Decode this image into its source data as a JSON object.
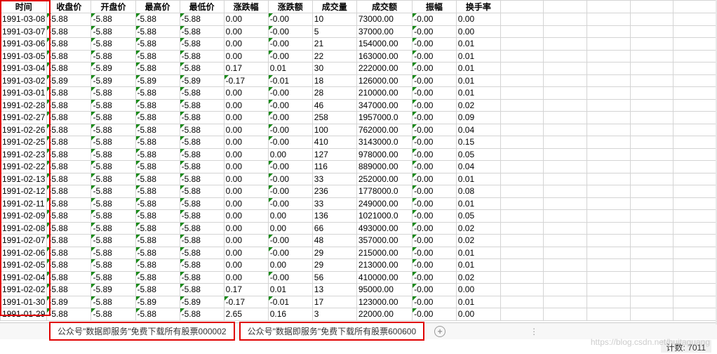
{
  "headers": [
    "时间",
    "收盘价",
    "开盘价",
    "最高价",
    "最低价",
    "涨跌幅",
    "涨跌额",
    "成交量",
    "成交额",
    "振幅",
    "换手率"
  ],
  "rows": [
    [
      "1991-03-08",
      "-5.88",
      "-5.88",
      "-5.88",
      "-5.88",
      "0.00",
      "-0.00",
      "10",
      "73000.00",
      "-0.00",
      "0.00"
    ],
    [
      "1991-03-07",
      "-5.88",
      "-5.88",
      "-5.88",
      "-5.88",
      "0.00",
      "-0.00",
      "5",
      "37000.00",
      "-0.00",
      "0.00"
    ],
    [
      "1991-03-06",
      "-5.88",
      "-5.88",
      "-5.88",
      "-5.88",
      "0.00",
      "-0.00",
      "21",
      "154000.00",
      "-0.00",
      "0.01"
    ],
    [
      "1991-03-05",
      "-5.88",
      "-5.88",
      "-5.88",
      "-5.88",
      "0.00",
      "-0.00",
      "22",
      "163000.00",
      "-0.00",
      "0.01"
    ],
    [
      "1991-03-04",
      "-5.88",
      "-5.89",
      "-5.88",
      "-5.88",
      "0.17",
      "0.01",
      "30",
      "222000.00",
      "-0.00",
      "0.01"
    ],
    [
      "1991-03-02",
      "-5.89",
      "-5.89",
      "-5.89",
      "-5.89",
      "-0.17",
      "-0.01",
      "18",
      "126000.00",
      "-0.00",
      "0.01"
    ],
    [
      "1991-03-01",
      "-5.88",
      "-5.88",
      "-5.88",
      "-5.88",
      "0.00",
      "-0.00",
      "28",
      "210000.00",
      "-0.00",
      "0.01"
    ],
    [
      "1991-02-28",
      "-5.88",
      "-5.88",
      "-5.88",
      "-5.88",
      "0.00",
      "-0.00",
      "46",
      "347000.00",
      "-0.00",
      "0.02"
    ],
    [
      "1991-02-27",
      "-5.88",
      "-5.88",
      "-5.88",
      "-5.88",
      "0.00",
      "-0.00",
      "258",
      "1957000.0",
      "-0.00",
      "0.09"
    ],
    [
      "1991-02-26",
      "-5.88",
      "-5.88",
      "-5.88",
      "-5.88",
      "0.00",
      "-0.00",
      "100",
      "762000.00",
      "-0.00",
      "0.04"
    ],
    [
      "1991-02-25",
      "-5.88",
      "-5.88",
      "-5.88",
      "-5.88",
      "0.00",
      "-0.00",
      "410",
      "3143000.0",
      "-0.00",
      "0.15"
    ],
    [
      "1991-02-23",
      "-5.88",
      "-5.88",
      "-5.88",
      "-5.88",
      "0.00",
      "0.00",
      "127",
      "978000.00",
      "-0.00",
      "0.05"
    ],
    [
      "1991-02-22",
      "-5.88",
      "-5.88",
      "-5.88",
      "-5.88",
      "0.00",
      "-0.00",
      "116",
      "889000.00",
      "-0.00",
      "0.04"
    ],
    [
      "1991-02-13",
      "-5.88",
      "-5.88",
      "-5.88",
      "-5.88",
      "0.00",
      "-0.00",
      "33",
      "252000.00",
      "-0.00",
      "0.01"
    ],
    [
      "1991-02-12",
      "-5.88",
      "-5.88",
      "-5.88",
      "-5.88",
      "0.00",
      "-0.00",
      "236",
      "1778000.0",
      "-0.00",
      "0.08"
    ],
    [
      "1991-02-11",
      "-5.88",
      "-5.88",
      "-5.88",
      "-5.88",
      "0.00",
      "-0.00",
      "33",
      "249000.00",
      "-0.00",
      "0.01"
    ],
    [
      "1991-02-09",
      "-5.88",
      "-5.88",
      "-5.88",
      "-5.88",
      "0.00",
      "0.00",
      "136",
      "1021000.0",
      "-0.00",
      "0.05"
    ],
    [
      "1991-02-08",
      "-5.88",
      "-5.88",
      "-5.88",
      "-5.88",
      "0.00",
      "0.00",
      "66",
      "493000.00",
      "-0.00",
      "0.02"
    ],
    [
      "1991-02-07",
      "-5.88",
      "-5.88",
      "-5.88",
      "-5.88",
      "0.00",
      "-0.00",
      "48",
      "357000.00",
      "-0.00",
      "0.02"
    ],
    [
      "1991-02-06",
      "-5.88",
      "-5.88",
      "-5.88",
      "-5.88",
      "0.00",
      "-0.00",
      "29",
      "215000.00",
      "-0.00",
      "0.01"
    ],
    [
      "1991-02-05",
      "-5.88",
      "-5.88",
      "-5.88",
      "-5.88",
      "0.00",
      "0.00",
      "29",
      "213000.00",
      "-0.00",
      "0.01"
    ],
    [
      "1991-02-04",
      "-5.88",
      "-5.88",
      "-5.88",
      "-5.88",
      "0.00",
      "-0.00",
      "56",
      "410000.00",
      "-0.00",
      "0.02"
    ],
    [
      "1991-02-02",
      "-5.88",
      "-5.89",
      "-5.88",
      "-5.88",
      "0.17",
      "0.01",
      "13",
      "95000.00",
      "-0.00",
      "0.00"
    ],
    [
      "1991-01-30",
      "-5.89",
      "-5.88",
      "-5.89",
      "-5.89",
      "-0.17",
      "-0.01",
      "17",
      "123000.00",
      "-0.00",
      "0.01"
    ],
    [
      "1991-01-29",
      "-5.88",
      "-5.88",
      "-5.88",
      "-5.88",
      "2.65",
      "0.16",
      "3",
      "22000.00",
      "-0.00",
      "0.00"
    ]
  ],
  "tabs": {
    "tab1": "公众号\"数据即服务\"免费下载所有股票000002",
    "tab2": "公众号\"数据即服务\"免费下载所有股票600600"
  },
  "countLabel": "计数: 7011",
  "watermark": "https://blog.csdn.net/huitaguang"
}
